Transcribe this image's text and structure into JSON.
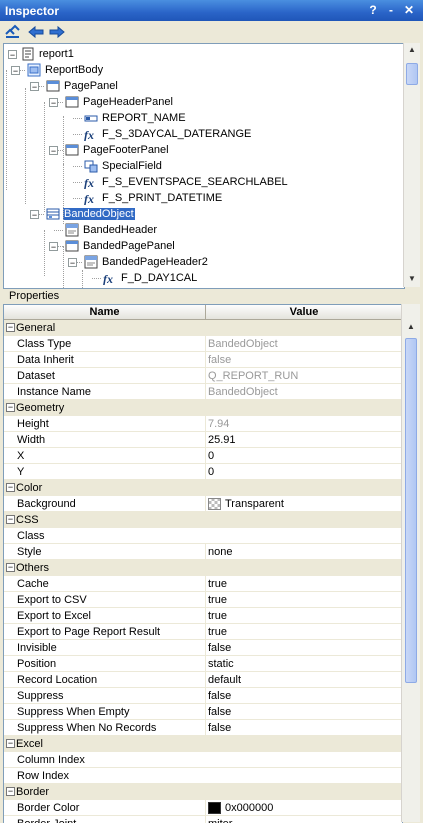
{
  "window": {
    "title": "Inspector",
    "help_glyph": "?",
    "dropdown_glyph": "-",
    "close_glyph": "✕"
  },
  "tree": {
    "nodes": [
      {
        "label": "report1",
        "icon": "report-icon",
        "expanded": true,
        "selected": false
      },
      {
        "label": "ReportBody",
        "icon": "report-body-icon",
        "expanded": true,
        "selected": false
      },
      {
        "label": "PagePanel",
        "icon": "panel-icon",
        "expanded": true,
        "selected": false
      },
      {
        "label": "PageHeaderPanel",
        "icon": "panel-icon",
        "expanded": true,
        "selected": false
      },
      {
        "label": "REPORT_NAME",
        "icon": "label-icon",
        "selected": false
      },
      {
        "label": "F_S_3DAYCAL_DATERANGE",
        "icon": "formula-icon",
        "selected": false
      },
      {
        "label": "PageFooterPanel",
        "icon": "panel-icon",
        "expanded": true,
        "selected": false
      },
      {
        "label": "SpecialField",
        "icon": "special-field-icon",
        "selected": false
      },
      {
        "label": "F_S_EVENTSPACE_SEARCHLABEL",
        "icon": "formula-icon",
        "selected": false
      },
      {
        "label": "F_S_PRINT_DATETIME",
        "icon": "formula-icon",
        "selected": false
      },
      {
        "label": "BandedObject",
        "icon": "banded-object-icon",
        "expanded": true,
        "selected": true
      },
      {
        "label": "BandedHeader",
        "icon": "banded-header-icon",
        "selected": false
      },
      {
        "label": "BandedPagePanel",
        "icon": "panel-icon",
        "expanded": true,
        "selected": false
      },
      {
        "label": "BandedPageHeader2",
        "icon": "banded-header-icon",
        "expanded": true,
        "selected": false
      },
      {
        "label": "F_D_DAY1CAL",
        "icon": "formula-icon",
        "selected": false
      }
    ]
  },
  "properties": {
    "section_label": "Properties",
    "col_name": "Name",
    "col_value": "Value",
    "rows": [
      {
        "type": "cat",
        "name": "General"
      },
      {
        "type": "prop",
        "name": "Class Type",
        "value": "BandedObject",
        "readonly": true
      },
      {
        "type": "prop",
        "name": "Data Inherit",
        "value": "false",
        "readonly": true
      },
      {
        "type": "prop",
        "name": "Dataset",
        "value": "Q_REPORT_RUN",
        "readonly": true
      },
      {
        "type": "prop",
        "name": "Instance Name",
        "value": "BandedObject",
        "readonly": true
      },
      {
        "type": "cat",
        "name": "Geometry"
      },
      {
        "type": "prop",
        "name": "Height",
        "value": "7.94",
        "readonly": true
      },
      {
        "type": "prop",
        "name": "Width",
        "value": "25.91"
      },
      {
        "type": "prop",
        "name": "X",
        "value": "0"
      },
      {
        "type": "prop",
        "name": "Y",
        "value": "0"
      },
      {
        "type": "cat",
        "name": "Color"
      },
      {
        "type": "prop",
        "name": "Background",
        "value": "Transparent",
        "swatch": "transparent"
      },
      {
        "type": "cat",
        "name": "CSS"
      },
      {
        "type": "prop",
        "name": "Class",
        "value": ""
      },
      {
        "type": "prop",
        "name": "Style",
        "value": "none"
      },
      {
        "type": "cat",
        "name": "Others"
      },
      {
        "type": "prop",
        "name": "Cache",
        "value": "true"
      },
      {
        "type": "prop",
        "name": "Export to CSV",
        "value": "true"
      },
      {
        "type": "prop",
        "name": "Export to Excel",
        "value": "true"
      },
      {
        "type": "prop",
        "name": "Export to Page Report Result",
        "value": "true"
      },
      {
        "type": "prop",
        "name": "Invisible",
        "value": "false"
      },
      {
        "type": "prop",
        "name": "Position",
        "value": "static"
      },
      {
        "type": "prop",
        "name": "Record Location",
        "value": "default"
      },
      {
        "type": "prop",
        "name": "Suppress",
        "value": "false"
      },
      {
        "type": "prop",
        "name": "Suppress When Empty",
        "value": "false"
      },
      {
        "type": "prop",
        "name": "Suppress When No Records",
        "value": "false"
      },
      {
        "type": "cat",
        "name": "Excel"
      },
      {
        "type": "prop",
        "name": "Column Index",
        "value": ""
      },
      {
        "type": "prop",
        "name": "Row Index",
        "value": ""
      },
      {
        "type": "cat",
        "name": "Border"
      },
      {
        "type": "prop",
        "name": "Border Color",
        "value": "0x000000",
        "swatch": "#000000"
      },
      {
        "type": "prop",
        "name": "Border Joint",
        "value": "miter"
      }
    ]
  },
  "colors": {
    "selection": "#316ac5",
    "title_bar": "#2a64c8"
  }
}
